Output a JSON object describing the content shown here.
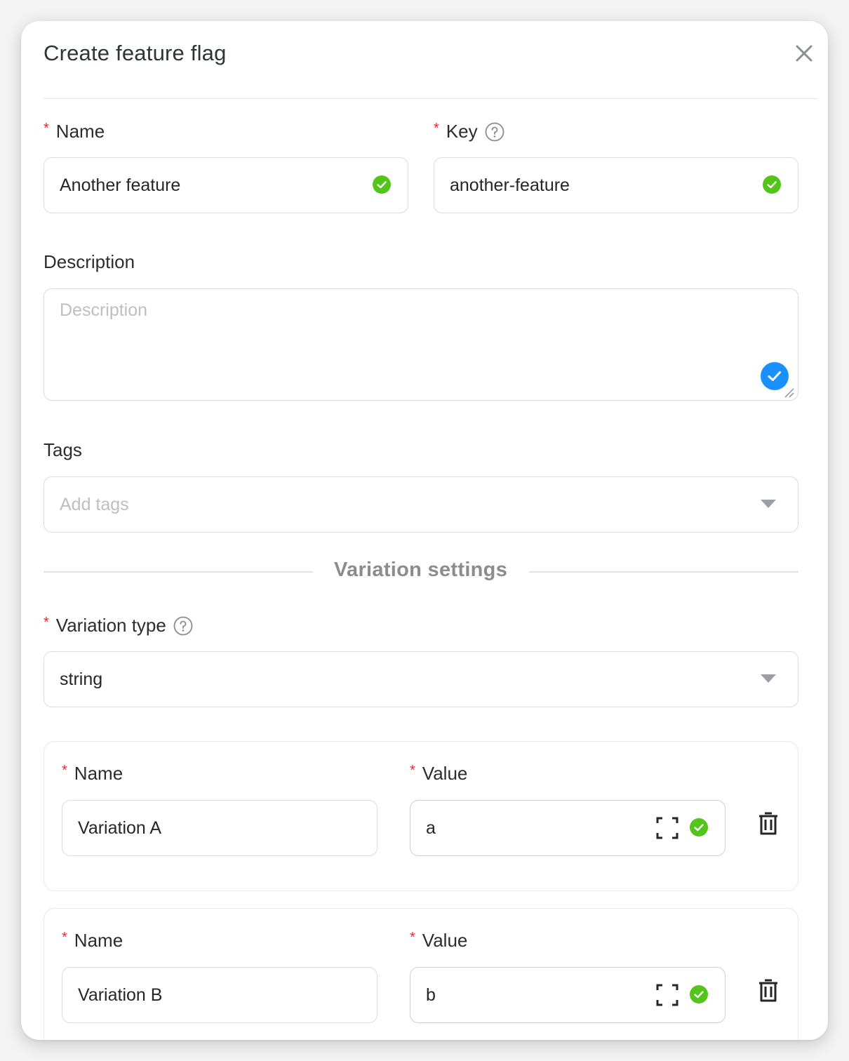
{
  "dialog": {
    "title": "Create feature flag"
  },
  "name_field": {
    "label": "Name",
    "value": "Another feature"
  },
  "key_field": {
    "label": "Key",
    "value": "another-feature"
  },
  "description_field": {
    "label": "Description",
    "placeholder": "Description",
    "value": ""
  },
  "tags_field": {
    "label": "Tags",
    "placeholder": "Add tags"
  },
  "variation_settings": {
    "title": "Variation settings",
    "type_label": "Variation type",
    "type_value": "string",
    "variations": [
      {
        "name_label": "Name",
        "name_value": "Variation A",
        "value_label": "Value",
        "value_value": "a"
      },
      {
        "name_label": "Name",
        "name_value": "Variation B",
        "value_label": "Value",
        "value_value": "b"
      }
    ]
  },
  "colors": {
    "valid_green": "#52c41a",
    "focus_blue": "#1890ff",
    "required_red": "#f5222d"
  },
  "icons": [
    "close-icon",
    "help-icon",
    "check-circle-icon",
    "caret-down-icon",
    "expand-icon",
    "trash-icon",
    "resize-handle-icon"
  ]
}
